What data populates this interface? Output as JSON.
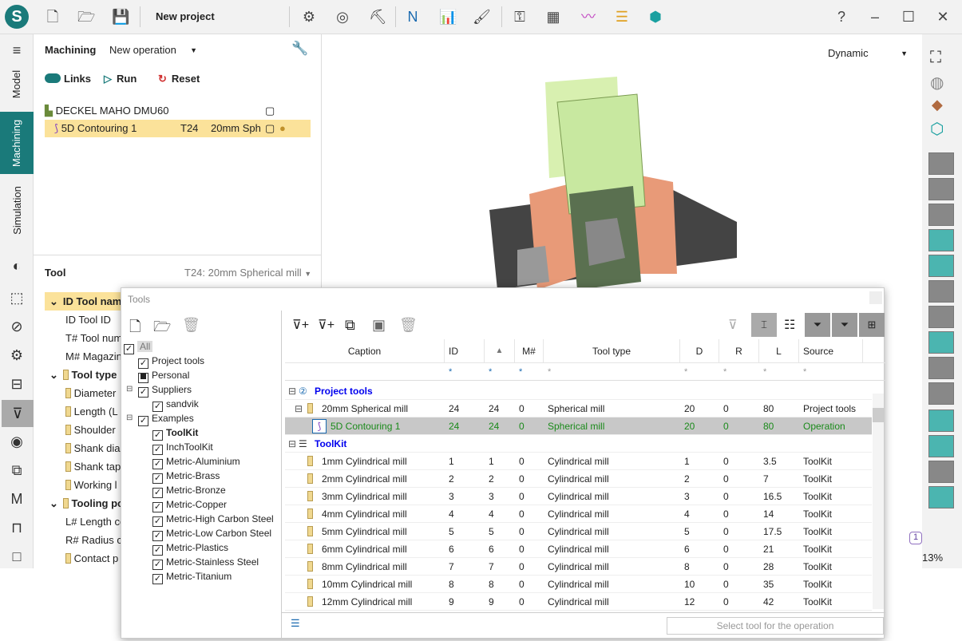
{
  "app": {
    "title": "New project",
    "help": "?"
  },
  "vtabs": [
    "Model",
    "Machining",
    "Simulation"
  ],
  "machining": {
    "label": "Machining",
    "operation_select": "New operation",
    "links": "Links",
    "run": "Run",
    "reset": "Reset",
    "tree": [
      {
        "label": "DECKEL MAHO DMU60"
      },
      {
        "label": "5D Contouring 1",
        "tool": "T24",
        "desc": "20mm Sph"
      }
    ]
  },
  "tool": {
    "label": "Tool",
    "selected": "T24: 20mm Spherical mill",
    "props": [
      {
        "label": "Tool name",
        "prefix": "ID",
        "group": true,
        "highlight": true
      },
      {
        "label": "Tool ID",
        "prefix": "ID"
      },
      {
        "label": "Tool num",
        "prefix": "T#"
      },
      {
        "label": "Magazine",
        "prefix": "M#"
      },
      {
        "label": "Tool type",
        "group": true
      },
      {
        "label": "Diameter"
      },
      {
        "label": "Length (L"
      },
      {
        "label": "Shoulder"
      },
      {
        "label": "Shank dia"
      },
      {
        "label": "Shank tap"
      },
      {
        "label": "Working l"
      },
      {
        "label": "Tooling po",
        "group": true
      },
      {
        "label": "Length co",
        "prefix": "L#"
      },
      {
        "label": "Radius co",
        "prefix": "R#"
      },
      {
        "label": "Contact p"
      }
    ]
  },
  "view": {
    "mode": "Dynamic",
    "zoom": "13%",
    "badge": "1"
  },
  "dialog": {
    "title": "Tools",
    "select_button": "Select tool for the operation",
    "tree": [
      {
        "label": "All",
        "level": 0,
        "state": "checked"
      },
      {
        "label": "Project tools",
        "level": 1,
        "state": "checked"
      },
      {
        "label": "Personal",
        "level": 1,
        "state": "partial"
      },
      {
        "label": "Suppliers",
        "level": 1,
        "state": "checked",
        "expand": true
      },
      {
        "label": "sandvik",
        "level": 2,
        "state": "checked"
      },
      {
        "label": "Examples",
        "level": 1,
        "state": "checked",
        "expand": true
      },
      {
        "label": "ToolKit",
        "level": 2,
        "state": "checked",
        "bold": true
      },
      {
        "label": "InchToolKit",
        "level": 2,
        "state": "checked"
      },
      {
        "label": "Metric-Aluminium",
        "level": 2,
        "state": "checked"
      },
      {
        "label": "Metric-Brass",
        "level": 2,
        "state": "checked"
      },
      {
        "label": "Metric-Bronze",
        "level": 2,
        "state": "checked"
      },
      {
        "label": "Metric-Copper",
        "level": 2,
        "state": "checked"
      },
      {
        "label": "Metric-High Carbon Steel",
        "level": 2,
        "state": "checked"
      },
      {
        "label": "Metric-Low Carbon Steel",
        "level": 2,
        "state": "checked"
      },
      {
        "label": "Metric-Plastics",
        "level": 2,
        "state": "checked"
      },
      {
        "label": "Metric-Stainless Steel",
        "level": 2,
        "state": "checked"
      },
      {
        "label": "Metric-Titanium",
        "level": 2,
        "state": "checked"
      }
    ],
    "columns": [
      "Caption",
      "ID",
      "▲",
      "M#",
      "Tool type",
      "D",
      "R",
      "L",
      "Source"
    ],
    "filter": "*",
    "groups": [
      {
        "label": "Project tools",
        "rows": [
          {
            "caption": "20mm Spherical mill",
            "id": "24",
            "t": "24",
            "m": "0",
            "type": "Spherical mill",
            "d": "20",
            "r": "0",
            "l": "80",
            "source": "Project tools"
          },
          {
            "caption": "5D Contouring 1",
            "id": "24",
            "t": "24",
            "m": "0",
            "type": "Spherical mill",
            "d": "20",
            "r": "0",
            "l": "80",
            "source": "Operation",
            "selected": true
          }
        ]
      },
      {
        "label": "ToolKit",
        "rows": [
          {
            "caption": "1mm Cylindrical mill",
            "id": "1",
            "t": "1",
            "m": "0",
            "type": "Cylindrical mill",
            "d": "1",
            "r": "0",
            "l": "3.5",
            "source": "ToolKit"
          },
          {
            "caption": "2mm Cylindrical mill",
            "id": "2",
            "t": "2",
            "m": "0",
            "type": "Cylindrical mill",
            "d": "2",
            "r": "0",
            "l": "7",
            "source": "ToolKit"
          },
          {
            "caption": "3mm Cylindrical mill",
            "id": "3",
            "t": "3",
            "m": "0",
            "type": "Cylindrical mill",
            "d": "3",
            "r": "0",
            "l": "16.5",
            "source": "ToolKit"
          },
          {
            "caption": "4mm Cylindrical mill",
            "id": "4",
            "t": "4",
            "m": "0",
            "type": "Cylindrical mill",
            "d": "4",
            "r": "0",
            "l": "14",
            "source": "ToolKit"
          },
          {
            "caption": "5mm Cylindrical mill",
            "id": "5",
            "t": "5",
            "m": "0",
            "type": "Cylindrical mill",
            "d": "5",
            "r": "0",
            "l": "17.5",
            "source": "ToolKit"
          },
          {
            "caption": "6mm Cylindrical mill",
            "id": "6",
            "t": "6",
            "m": "0",
            "type": "Cylindrical mill",
            "d": "6",
            "r": "0",
            "l": "21",
            "source": "ToolKit"
          },
          {
            "caption": "8mm Cylindrical mill",
            "id": "7",
            "t": "7",
            "m": "0",
            "type": "Cylindrical mill",
            "d": "8",
            "r": "0",
            "l": "28",
            "source": "ToolKit"
          },
          {
            "caption": "10mm Cylindrical mill",
            "id": "8",
            "t": "8",
            "m": "0",
            "type": "Cylindrical mill",
            "d": "10",
            "r": "0",
            "l": "35",
            "source": "ToolKit"
          },
          {
            "caption": "12mm Cylindrical mill",
            "id": "9",
            "t": "9",
            "m": "0",
            "type": "Cylindrical mill",
            "d": "12",
            "r": "0",
            "l": "42",
            "source": "ToolKit"
          }
        ]
      }
    ]
  },
  "colors": {
    "accent": "#1a7a7a",
    "highlight": "#fbe29a",
    "group": "#0000ee",
    "operation": "#1a8a1a"
  }
}
